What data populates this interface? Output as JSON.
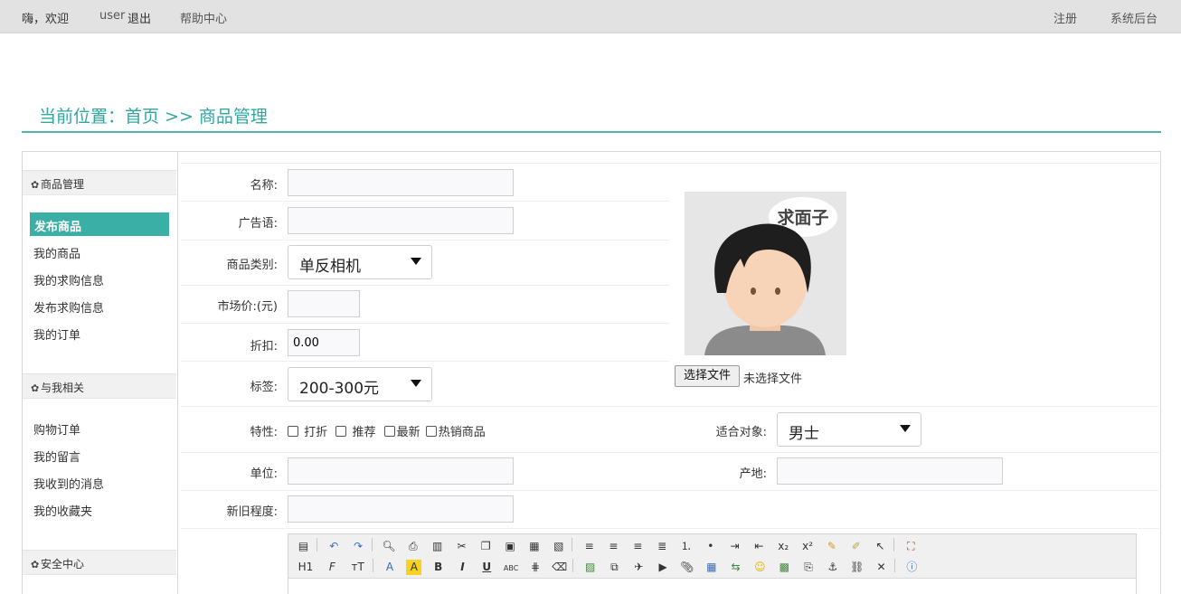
{
  "topbar": {
    "greeting": "嗨，欢迎",
    "user": "user",
    "logout": "退出",
    "help": "帮助中心",
    "register": "注册",
    "admin": "系统后台"
  },
  "breadcrumb": "当前位置：首页 >> 商品管理",
  "sidebar": {
    "sections": [
      {
        "title": "商品管理",
        "items": [
          "发布商品",
          "我的商品",
          "我的求购信息",
          "发布求购信息",
          "我的订单"
        ]
      },
      {
        "title": "与我相关",
        "items": [
          "购物订单",
          "我的留言",
          "我收到的消息",
          "我的收藏夹"
        ]
      },
      {
        "title": "安全中心",
        "items": []
      }
    ],
    "active_item": "发布商品"
  },
  "form": {
    "name_label": "名称:",
    "name_value": "",
    "slogan_label": "广告语:",
    "slogan_value": "",
    "category_label": "商品类别:",
    "category_value": "单反相机",
    "market_price_label": "市场价:(元)",
    "market_price_value": "",
    "discount_label": "折扣:",
    "discount_value": "0.00",
    "tag_label": "标签:",
    "tag_value": "200-300元",
    "features_label": "特性:",
    "features": [
      "打折",
      "推荐",
      "最新",
      "热销商品"
    ],
    "audience_label": "适合对象:",
    "audience_value": "男士",
    "unit_label": "单位:",
    "unit_value": "",
    "origin_label": "产地:",
    "origin_value": "",
    "condition_label": "新旧程度:",
    "condition_value": ""
  },
  "avatar": {
    "speech_text": "求面子",
    "choose_file": "选择文件",
    "no_file": "未选择文件"
  },
  "editor": {
    "toolbar_row1": [
      "source-icon",
      "undo-icon",
      "redo-icon",
      "preview-icon",
      "print-icon",
      "template-icon",
      "cut-icon",
      "copy-icon",
      "paste-icon",
      "paste-text-icon",
      "paste-word-icon",
      "align-left-icon",
      "align-center-icon",
      "align-right-icon",
      "justify-icon",
      "ordered-list-icon",
      "unordered-list-icon",
      "indent-icon",
      "outdent-icon",
      "subscript-icon",
      "superscript-icon",
      "clear-format-icon",
      "select-all-icon",
      "pointer-icon",
      "fullscreen-icon"
    ],
    "toolbar_row2": [
      "heading-icon",
      "font-family-icon",
      "font-size-icon",
      "font-color-icon",
      "highlight-icon",
      "bold-icon",
      "italic-icon",
      "underline-icon",
      "strikethrough-icon",
      "line-height-icon",
      "remove-format-icon",
      "image-icon",
      "multi-image-icon",
      "flash-icon",
      "media-icon",
      "attachment-icon",
      "table-icon",
      "insert-code-icon",
      "emoticon-icon",
      "baidu-map-icon",
      "page-break-icon",
      "anchor-icon",
      "link-icon",
      "unlink-icon",
      "about-icon"
    ],
    "toolbar_row2_labels": [
      "H1",
      "F",
      "тT"
    ]
  }
}
